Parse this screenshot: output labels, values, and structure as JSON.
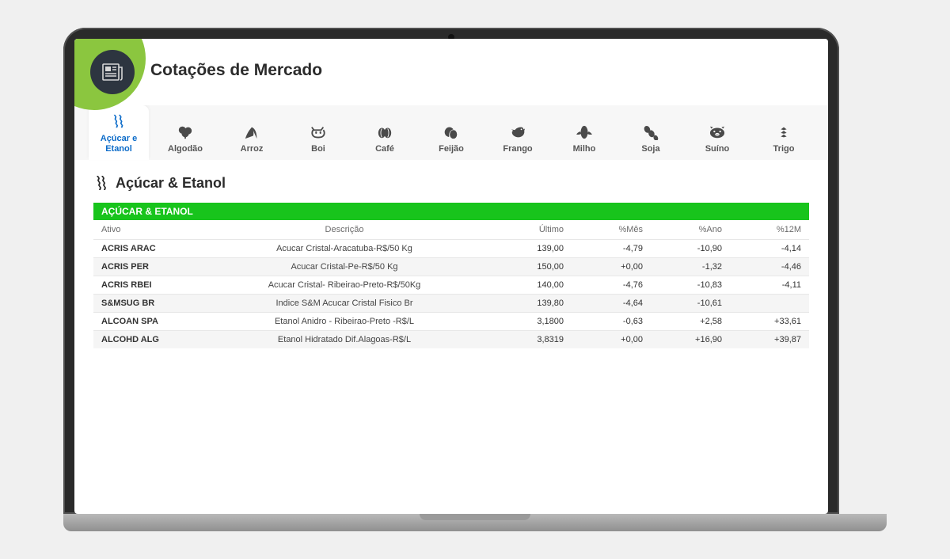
{
  "header": {
    "title": "Cotações de Mercado"
  },
  "tabs": [
    {
      "id": "acucar-etanol",
      "label": "Açúcar e Etanol",
      "icon": "sugarcane",
      "active": true
    },
    {
      "id": "algodao",
      "label": "Algodão",
      "icon": "cotton"
    },
    {
      "id": "arroz",
      "label": "Arroz",
      "icon": "rice"
    },
    {
      "id": "boi",
      "label": "Boi",
      "icon": "cow"
    },
    {
      "id": "cafe",
      "label": "Café",
      "icon": "coffee"
    },
    {
      "id": "feijao",
      "label": "Feijão",
      "icon": "beans"
    },
    {
      "id": "frango",
      "label": "Frango",
      "icon": "chicken"
    },
    {
      "id": "milho",
      "label": "Milho",
      "icon": "corn"
    },
    {
      "id": "soja",
      "label": "Soja",
      "icon": "soy"
    },
    {
      "id": "suino",
      "label": "Suíno",
      "icon": "pig"
    },
    {
      "id": "trigo",
      "label": "Trigo",
      "icon": "wheat"
    }
  ],
  "section": {
    "title": "Açúcar & Etanol",
    "band": "AÇÚCAR & ETANOL",
    "columns": {
      "ativo": "Ativo",
      "descricao": "Descrição",
      "ultimo": "Último",
      "mes": "%Mês",
      "ano": "%Ano",
      "m12": "%12M"
    },
    "rows": [
      {
        "ativo": "ACRIS ARAC",
        "descricao": "Acucar Cristal-Aracatuba-R$/50 Kg",
        "ultimo": "139,00",
        "mes": "-4,79",
        "ano": "-10,90",
        "m12": "-4,14"
      },
      {
        "ativo": "ACRIS PER",
        "descricao": "Acucar Cristal-Pe-R$/50 Kg",
        "ultimo": "150,00",
        "mes": "+0,00",
        "ano": "-1,32",
        "m12": "-4,46"
      },
      {
        "ativo": "ACRIS RBEI",
        "descricao": "Acucar Cristal- Ribeirao-Preto-R$/50Kg",
        "ultimo": "140,00",
        "mes": "-4,76",
        "ano": "-10,83",
        "m12": "-4,11"
      },
      {
        "ativo": "S&MSUG BR",
        "descricao": "Indice S&M Acucar Cristal Fisico Br",
        "ultimo": "139,80",
        "mes": "-4,64",
        "ano": "-10,61",
        "m12": ""
      },
      {
        "ativo": "ALCOAN SPA",
        "descricao": "Etanol Anidro - Ribeirao-Preto -R$/L",
        "ultimo": "3,1800",
        "mes": "-0,63",
        "ano": "+2,58",
        "m12": "+33,61"
      },
      {
        "ativo": "ALCOHD ALG",
        "descricao": "Etanol Hidratado Dif.Alagoas-R$/L",
        "ultimo": "3,8319",
        "mes": "+0,00",
        "ano": "+16,90",
        "m12": "+39,87"
      }
    ]
  },
  "colors": {
    "accent": "#18c41c",
    "tabActive": "#0d6cc9",
    "green": "#8bc63f"
  }
}
